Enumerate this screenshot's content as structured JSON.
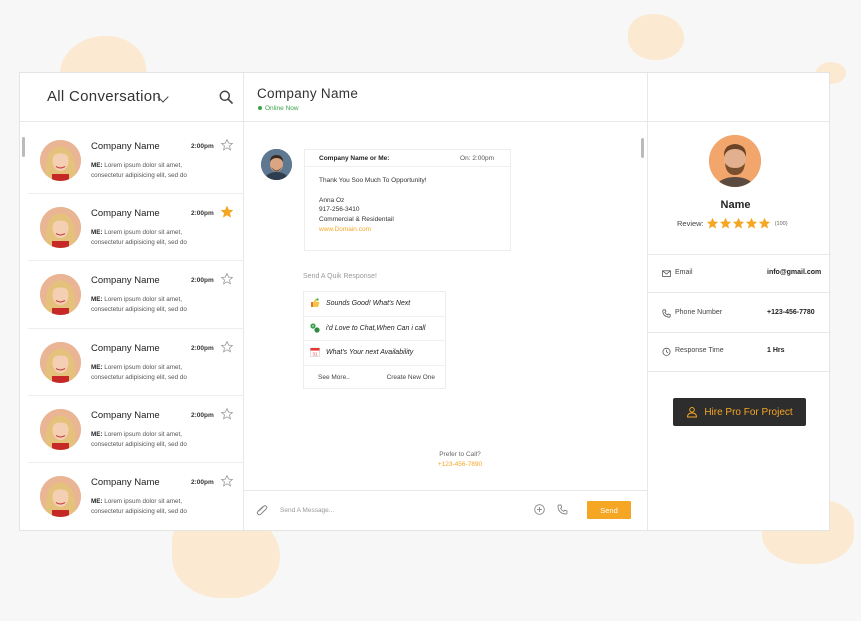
{
  "sidebar": {
    "title": "All Conversation",
    "conversations": [
      {
        "name": "Company Name",
        "time": "2:00pm",
        "prefix": "ME:",
        "message": "Lorem ipsum dolor sit amet, consectetur adipisicing elit, sed do",
        "starred": false
      },
      {
        "name": "Company Name",
        "time": "2:00pm",
        "prefix": "ME:",
        "message": "Lorem ipsum dolor sit amet, consectetur adipisicing elit, sed do",
        "starred": true
      },
      {
        "name": "Company Name",
        "time": "2:00pm",
        "prefix": "ME:",
        "message": "Lorem ipsum dolor sit amet, consectetur adipisicing elit, sed do",
        "starred": false
      },
      {
        "name": "Company Name",
        "time": "2:00pm",
        "prefix": "ME:",
        "message": "Lorem ipsum dolor sit amet, consectetur adipisicing elit, sed do",
        "starred": false
      },
      {
        "name": "Company Name",
        "time": "2:00pm",
        "prefix": "ME:",
        "message": "Lorem ipsum dolor sit amet, consectetur adipisicing elit, sed do",
        "starred": false
      },
      {
        "name": "Company Name",
        "time": "2:00pm",
        "prefix": "ME:",
        "message": "Lorem ipsum dolor sit amet, consectetur adipisicing elit, sed do",
        "starred": false
      }
    ]
  },
  "chat": {
    "title": "Company Name",
    "status": "Online Now",
    "message": {
      "from": "Company Name  or Me:",
      "time": "On: 2:00pm",
      "greeting": "Thank You Soo Much To Opportunity!",
      "contact_name": "Anna Oz",
      "contact_phone": "917-256-3410",
      "contact_role": "Commercial & Residentail",
      "contact_link": "www.Domain.com"
    },
    "quick_title": "Send A Quik Response!",
    "quick_responses": [
      {
        "text": "Sounds Good! What's Next",
        "icon": "thumbs-up-icon"
      },
      {
        "text": "i'd Love to Chat,When Can i call",
        "icon": "chat-bubbles-icon"
      },
      {
        "text": "What's Your next Availability",
        "icon": "calendar-icon"
      }
    ],
    "see_more": "See More..",
    "create_new": "Create New One",
    "prefer_call": "Prefer to Call?",
    "prefer_phone": "+123-456-7890",
    "input_placeholder": "Send A Message...",
    "send_label": "Send"
  },
  "profile": {
    "name": "Name",
    "review_label": "Review:",
    "rating": 5,
    "review_count": "(100)",
    "email_label": "Email",
    "email_value": "info@gmail.com",
    "phone_label": "Phone Number",
    "phone_value": "+123-456-7780",
    "response_label": "Response Time",
    "response_value": "1 Hrs",
    "hire_label": "Hire Pro For Project"
  },
  "colors": {
    "accent": "#f5a623",
    "online": "#3aa34a",
    "dark_button": "#2d2d2d"
  }
}
